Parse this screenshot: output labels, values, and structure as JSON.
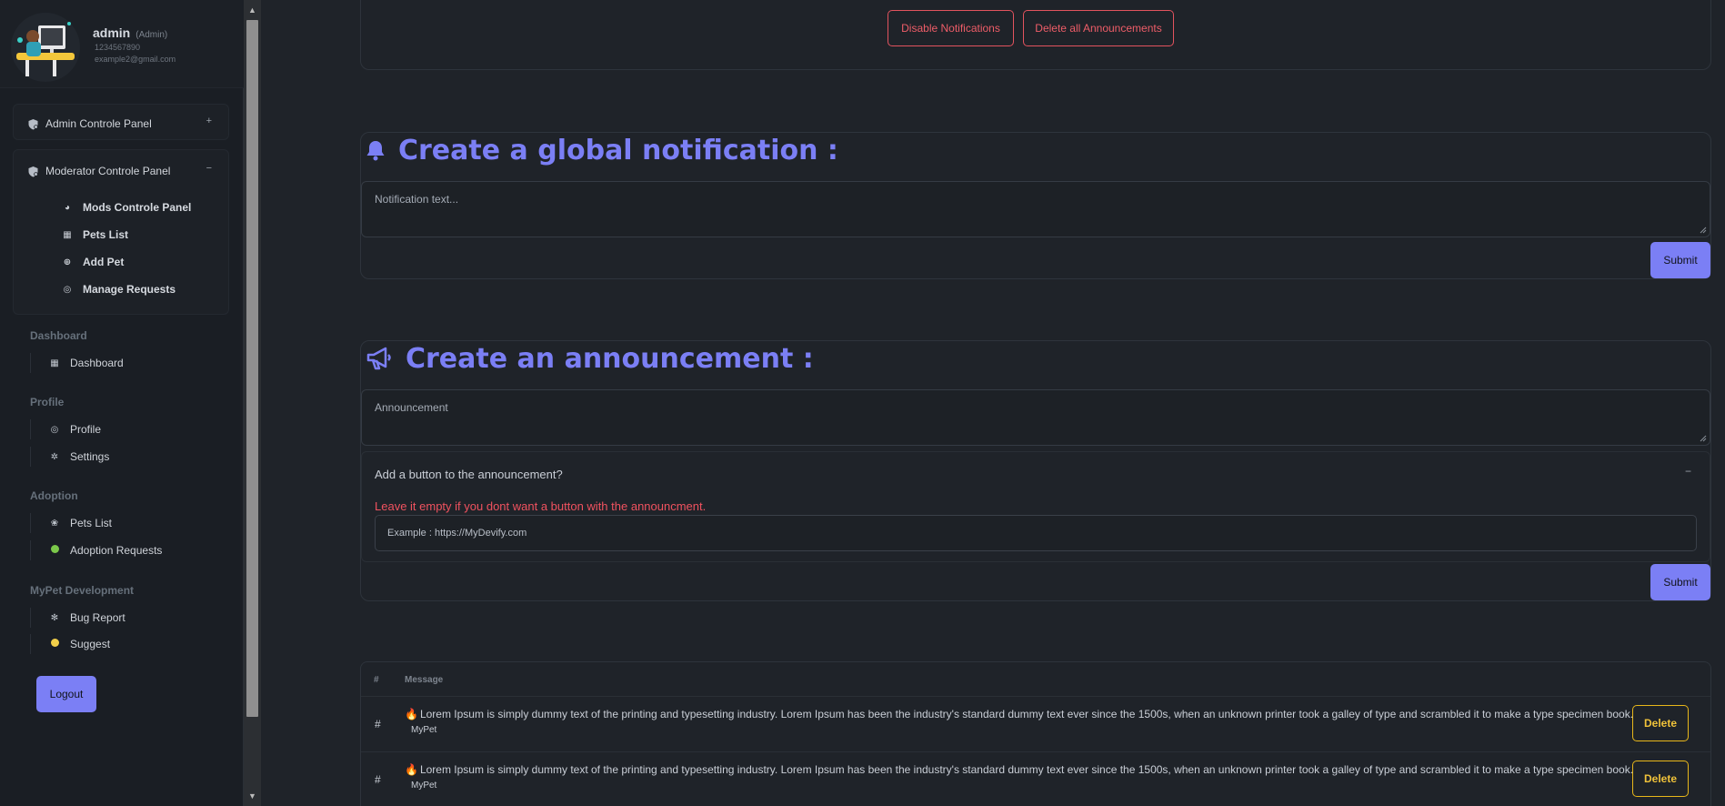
{
  "profile": {
    "name": "admin",
    "role": "(Admin)",
    "phone": "1234567890",
    "email": "example2@gmail.com"
  },
  "admin_panel": {
    "label": "Admin Controle Panel",
    "toggle": "+"
  },
  "moderator_panel": {
    "label": "Moderator Controle Panel",
    "toggle": "−",
    "items": [
      {
        "label": "Mods Controle Panel",
        "icon": "palette-icon"
      },
      {
        "label": "Pets List",
        "icon": "list-icon"
      },
      {
        "label": "Add Pet",
        "icon": "plus-circle-icon"
      },
      {
        "label": "Manage Requests",
        "icon": "user-circle-icon"
      }
    ]
  },
  "nav": {
    "dashboard": {
      "section": "Dashboard",
      "items": [
        {
          "label": "Dashboard",
          "icon": "grid-icon"
        }
      ]
    },
    "profile": {
      "section": "Profile",
      "items": [
        {
          "label": "Profile",
          "icon": "user-circle-icon"
        },
        {
          "label": "Settings",
          "icon": "gear-icon"
        }
      ]
    },
    "adoption": {
      "section": "Adoption",
      "items": [
        {
          "label": "Pets List",
          "icon": "paw-icon"
        },
        {
          "label": "Adoption Requests",
          "icon": "green-dot-icon"
        }
      ]
    },
    "dev": {
      "section": "MyPet Development",
      "items": [
        {
          "label": "Bug Report",
          "icon": "bug-icon"
        },
        {
          "label": "Suggest",
          "icon": "yellow-dot-icon"
        }
      ]
    }
  },
  "logout_label": "Logout",
  "top_actions": {
    "disable_notifications": "Disable Notifications",
    "delete_announcements": "Delete all Announcements"
  },
  "notification": {
    "title": "Create a global notification :",
    "placeholder": "Notification text...",
    "submit": "Submit"
  },
  "announcement": {
    "title": "Create an announcement :",
    "placeholder": "Announcement",
    "button_question": "Add a button to the announcement?",
    "button_toggle": "−",
    "warning": "Leave it empty if you dont want a button with the announcment.",
    "url_placeholder": "Example : https://MyDevify.com",
    "submit": "Submit"
  },
  "table": {
    "headers": [
      "#",
      "Message"
    ],
    "rows": [
      {
        "index": "#",
        "message": "Lorem Ipsum is simply dummy text of the printing and typesetting industry. Lorem Ipsum has been the industry's standard dummy text ever since the 1500s, when an unknown printer took a galley of type and scrambled it to make a type specimen book.",
        "author": "MyPet",
        "action": "Delete"
      },
      {
        "index": "#",
        "message": "Lorem Ipsum is simply dummy text of the printing and typesetting industry. Lorem Ipsum has been the industry's standard dummy text ever since the 1500s, when an unknown printer took a galley of type and scrambled it to make a type specimen book.",
        "author": "MyPet",
        "action": "Delete"
      }
    ]
  },
  "colors": {
    "accent": "#7b7ff5",
    "danger": "#ee5d68",
    "warning": "#f0c23a",
    "background": "#1f2329",
    "sidebar": "#1a1e24"
  }
}
